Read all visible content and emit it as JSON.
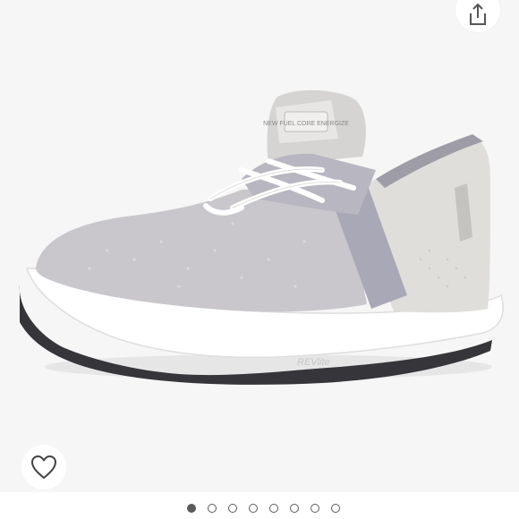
{
  "gallery": {
    "image_alt": "Light gray knit slip-on sneaker with white laces",
    "slide_count": 8,
    "active_index": 0
  },
  "shoe": {
    "tongue_logo_text": "NEW FUEL CORE ENERGIZE",
    "midsole_text": "REVlite"
  },
  "colors": {
    "background": "#f6f6f6",
    "upper": "#c9c7cc",
    "strap": "#a9a8b6",
    "sole": "#ffffff",
    "outsole": "#35353a",
    "dot": "#5a5a5a"
  },
  "icons": {
    "share": "share-icon",
    "wishlist": "heart-outline-icon"
  }
}
